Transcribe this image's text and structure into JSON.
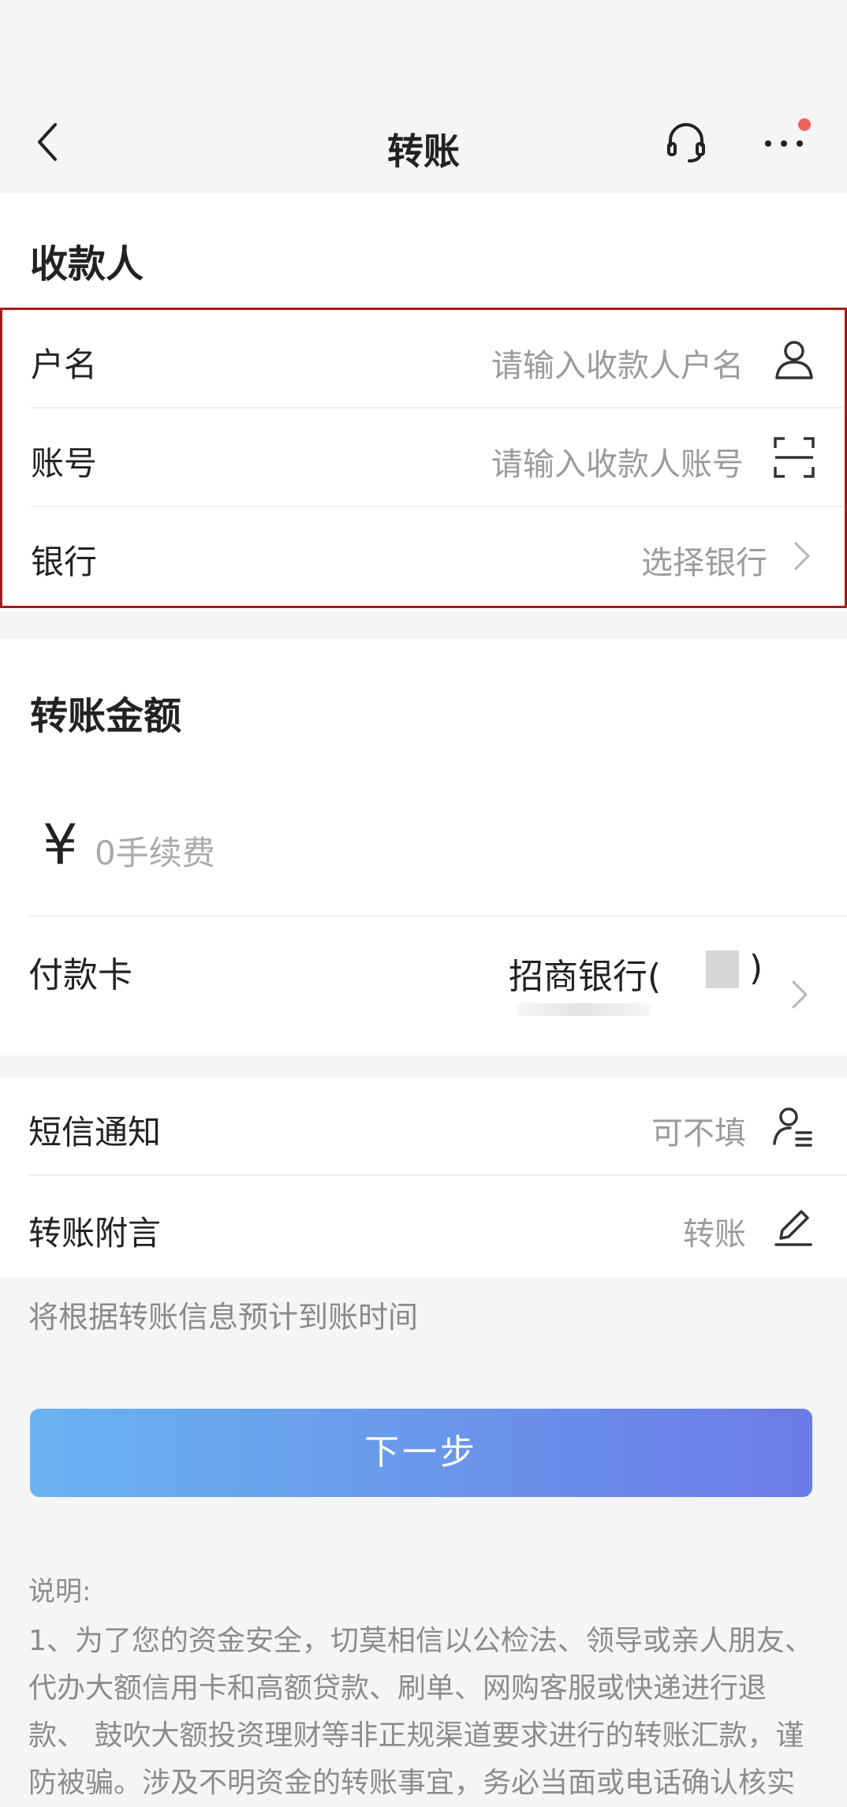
{
  "nav": {
    "title": "转账",
    "back_icon": "chevron-left-icon",
    "service_icon": "headset-icon",
    "more_icon": "more-dots-icon",
    "notification_dot_color": "#f0645a"
  },
  "payee": {
    "title": "收款人",
    "name_label": "户名",
    "name_placeholder": "请输入收款人户名",
    "account_label": "账号",
    "account_placeholder": "请输入收款人账号",
    "bank_label": "银行",
    "bank_placeholder": "选择银行",
    "highlight_color": "#a81a1a"
  },
  "amount": {
    "title": "转账金额",
    "currency": "¥",
    "fee_placeholder": "0手续费",
    "pay_card_label": "付款卡",
    "pay_card_bank": "招商银行",
    "pay_card_paren_open": "(",
    "pay_card_paren_close": ")"
  },
  "extras": {
    "sms_label": "短信通知",
    "sms_value": "可不填",
    "memo_label": "转账附言",
    "memo_value": "转账"
  },
  "hint": "将根据转账信息预计到账时间",
  "next_button": "下一步",
  "notes": {
    "title": "说明:",
    "body": "1、为了您的资金安全，切莫相信以公检法、领导或亲人朋友、代办大额信用卡和高额贷款、刷单、网购客服或快递进行退款、 鼓吹大额投资理财等非正规渠道要求进行的转账汇款，谨防被骗。涉及不明资金的转账事宜，务必当面或电话确认核实"
  }
}
